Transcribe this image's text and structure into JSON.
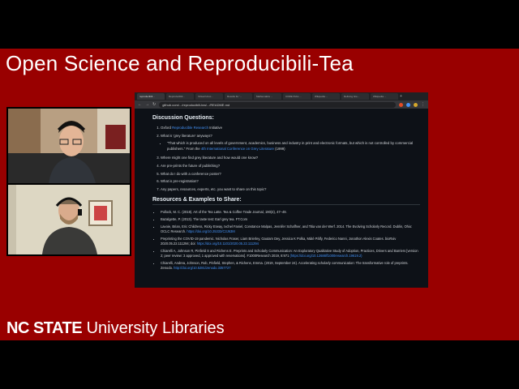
{
  "slide": {
    "title": "Open Science and Reproducibili-Tea",
    "footer_bold": "NC STATE",
    "footer_light": "University Libraries"
  },
  "browser": {
    "tabs": [
      "reproducibili...",
      "Reproducibili...",
      "Virtual Unco...",
      "Results for '...",
      "Mathematics ...",
      "CORE Pubs ...",
      "Wikipedia ...",
      "Defining Gre...",
      "Wikipedia ..."
    ],
    "url": "github.com/.../reproducibili-tea/.../README.md"
  },
  "doc": {
    "heading1": "Discussion Questions:",
    "q1_prefix": "Oxford ",
    "q1_link": "Reproducible Research",
    "q1_suffix": " Initiative",
    "q2": "What is 'grey literature' anyways?",
    "q2_sub_text": "\"That which is produced on all levels of government, academics, business and industry in print and electronic formats, but which is not controlled by commercial publishers.\" From the ",
    "q2_sub_link": "4th International Conference on Grey Literature",
    "q2_sub_year": " (1999)",
    "q3": "Where might one find grey literature and how would one know?",
    "q4": "Are pre-prints the future of publishing?",
    "q5": "What do I do with a conference poster?",
    "q6": "What is pre-registration?",
    "q7": "Any papers, resources, experts, etc. you want to share on this topic?",
    "heading2": "Resources & Examples to Share:",
    "r1": "Pollock, M. C. (2018). Art of the Tea Latte. Tea & Coffee Trade Journal, 190(4), 47–49.",
    "r2": "Bazalgette, P. (2013). The taste test: Earl grey tea. FT.Com",
    "r3_text": "Lavoie, Brian, Eric Childress, Ricky Erway, Ixchel Faniel, Constance Malpas, Jennifer Schaffner, and Titia van der Werf. 2014. The Evolving Scholarly Record. Dublin, Ohio: OCLC Research. ",
    "r3_link": "https://doi.org/10.25333/C3J63M",
    "r4_text": "Preprinting the COVID-19 pandemic. Nicholas Fraser, Liam Brierley, Gautam Dey, Jessica K Polka, Máté Pálfy, Federico Nanni, Jonathon Alexis Coates. bioRxiv 2020.05.22.111294; doi: ",
    "r4_link": "https://doi.org/10.1101/2020.05.22.111294",
    "r5_text": "Chiarelli A, Johnson R, Pinfield S and Richens E. Preprints and Scholarly Communication: An Exploratory Qualitative Study of Adoption, Practices, Drivers and Barriers [version 2; peer review: 3 approved, 1 approved with reservations]. F1000Research 2019, 8:971 ",
    "r5_link": "(https://doi.org/10.12688/f1000research.19619.2)",
    "r6_text": "Chiarelli, Andrea, Johnson, Rob, Pinfield, Stephen, & Richens, Emma. (2019, September 24). Accelerating scholarly communication: The transformative role of preprints. Zenodo. ",
    "r6_link": "http://doi.org/10.5281/zenodo.3357727"
  },
  "colors": {
    "slide_red": "#990000",
    "browser_bg": "#0d1117",
    "link": "#4493f8"
  }
}
